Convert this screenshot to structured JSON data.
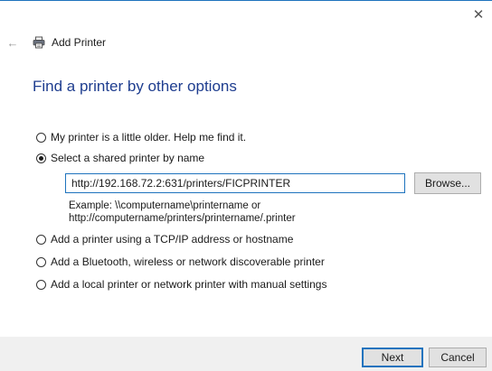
{
  "window": {
    "close_glyph": "✕",
    "back_glyph": "←",
    "title": "Add Printer"
  },
  "heading": "Find a printer by other options",
  "options": [
    {
      "label": "My printer is a little older. Help me find it.",
      "selected": false
    },
    {
      "label": "Select a shared printer by name",
      "selected": true
    },
    {
      "label": "Add a printer using a TCP/IP address or hostname",
      "selected": false
    },
    {
      "label": "Add a Bluetooth, wireless or network discoverable printer",
      "selected": false
    },
    {
      "label": "Add a local printer or network printer with manual settings",
      "selected": false
    }
  ],
  "shared_printer": {
    "value": "http://192.168.72.2:631/printers/FICPRINTER",
    "browse_label": "Browse...",
    "example_line1": "Example: \\\\computername\\printername or",
    "example_line2": "http://computername/printers/printername/.printer"
  },
  "footer": {
    "next_label": "Next",
    "cancel_label": "Cancel"
  },
  "colors": {
    "accent": "#1e73be",
    "heading": "#1e3d8f",
    "footer_bg": "#f0f0f0"
  },
  "icons": {
    "title": "printer-icon",
    "back": "back-arrow-icon",
    "close": "close-icon"
  }
}
